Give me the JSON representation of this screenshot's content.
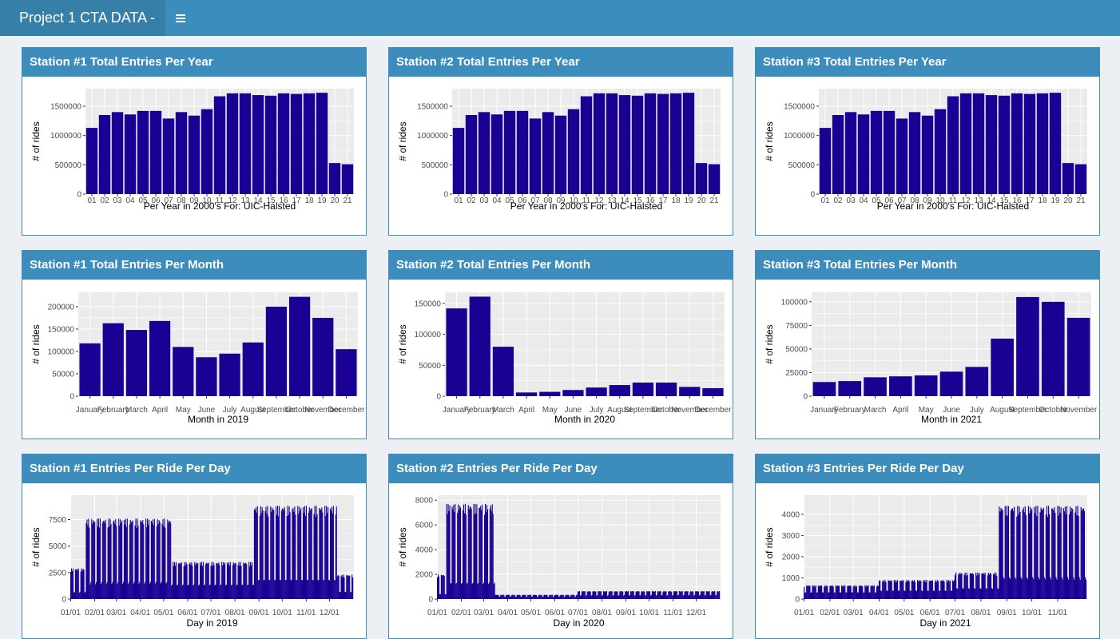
{
  "app": {
    "title": "Project 1 CTA DATA -",
    "menu_icon": "hamburger-menu-icon"
  },
  "colors": {
    "header": "#3c8dbc",
    "logo": "#367fa9",
    "bar": "#1a0093",
    "panel": "#ebebeb",
    "grid": "#ffffff",
    "page_bg": "#ecf0f5"
  },
  "boxes": [
    {
      "title": "Station #1 Total Entries Per Year",
      "chart_data": {
        "type": "bar",
        "categories": [
          "01",
          "02",
          "03",
          "04",
          "05",
          "06",
          "07",
          "08",
          "09",
          "10",
          "11",
          "12",
          "13",
          "14",
          "15",
          "16",
          "17",
          "18",
          "19",
          "20",
          "21"
        ],
        "values": [
          1130000,
          1350000,
          1400000,
          1360000,
          1420000,
          1420000,
          1290000,
          1400000,
          1340000,
          1450000,
          1670000,
          1720000,
          1720000,
          1690000,
          1680000,
          1720000,
          1710000,
          1720000,
          1730000,
          530000,
          510000
        ],
        "xlabel": "Per Year in 2000's For: UIC-Halsted",
        "ylabel": "# of rides",
        "ylim": [
          0,
          1800000
        ],
        "yticks": [
          0,
          500000,
          1000000,
          1500000
        ],
        "ytick_labels": [
          "0",
          "500000",
          "1000000",
          "1500000"
        ],
        "grid": true
      }
    },
    {
      "title": "Station #2 Total Entries Per Year",
      "chart_data": {
        "type": "bar",
        "categories": [
          "01",
          "02",
          "03",
          "04",
          "05",
          "06",
          "07",
          "08",
          "09",
          "10",
          "11",
          "12",
          "13",
          "14",
          "15",
          "16",
          "17",
          "18",
          "19",
          "20",
          "21"
        ],
        "values": [
          1130000,
          1350000,
          1400000,
          1360000,
          1420000,
          1420000,
          1290000,
          1400000,
          1340000,
          1450000,
          1670000,
          1720000,
          1720000,
          1690000,
          1680000,
          1720000,
          1710000,
          1720000,
          1730000,
          530000,
          510000
        ],
        "xlabel": "Per Year in 2000's For: UIC-Halsted",
        "ylabel": "# of rides",
        "ylim": [
          0,
          1800000
        ],
        "yticks": [
          0,
          500000,
          1000000,
          1500000
        ],
        "ytick_labels": [
          "0",
          "500000",
          "1000000",
          "1500000"
        ],
        "grid": true
      }
    },
    {
      "title": "Station #3 Total Entries Per Year",
      "chart_data": {
        "type": "bar",
        "categories": [
          "01",
          "02",
          "03",
          "04",
          "05",
          "06",
          "07",
          "08",
          "09",
          "10",
          "11",
          "12",
          "13",
          "14",
          "15",
          "16",
          "17",
          "18",
          "19",
          "20",
          "21"
        ],
        "values": [
          1130000,
          1350000,
          1400000,
          1360000,
          1420000,
          1420000,
          1290000,
          1400000,
          1340000,
          1450000,
          1670000,
          1720000,
          1720000,
          1690000,
          1680000,
          1720000,
          1710000,
          1720000,
          1730000,
          530000,
          510000
        ],
        "xlabel": "Per Year in 2000's For: UIC-Halsted",
        "ylabel": "# of rides",
        "ylim": [
          0,
          1800000
        ],
        "yticks": [
          0,
          500000,
          1000000,
          1500000
        ],
        "ytick_labels": [
          "0",
          "500000",
          "1000000",
          "1500000"
        ],
        "grid": true
      }
    },
    {
      "title": "Station #1 Total Entries Per Month",
      "chart_data": {
        "type": "bar",
        "categories": [
          "January",
          "February",
          "March",
          "April",
          "May",
          "June",
          "July",
          "August",
          "September",
          "October",
          "November",
          "December"
        ],
        "values": [
          118000,
          163000,
          148000,
          168000,
          110000,
          87000,
          95000,
          120000,
          200000,
          222000,
          175000,
          105000
        ],
        "xlabel": "Month in 2019",
        "ylabel": "# of rides",
        "ylim": [
          0,
          232000
        ],
        "yticks": [
          0,
          50000,
          100000,
          150000,
          200000
        ],
        "ytick_labels": [
          "0",
          "50000",
          "100000",
          "150000",
          "200000"
        ],
        "grid": true
      }
    },
    {
      "title": "Station #2 Total Entries Per Month",
      "chart_data": {
        "type": "bar",
        "categories": [
          "January",
          "February",
          "March",
          "April",
          "May",
          "June",
          "July",
          "August",
          "September",
          "October",
          "November",
          "December"
        ],
        "values": [
          142000,
          161000,
          80000,
          6000,
          7000,
          10000,
          14000,
          18000,
          22000,
          22000,
          15000,
          13000
        ],
        "xlabel": "Month in 2020",
        "ylabel": "# of rides",
        "ylim": [
          0,
          168000
        ],
        "yticks": [
          0,
          50000,
          100000,
          150000
        ],
        "ytick_labels": [
          "0",
          "50000",
          "100000",
          "150000"
        ],
        "grid": true
      }
    },
    {
      "title": "Station #3 Total Entries Per Month",
      "chart_data": {
        "type": "bar",
        "categories": [
          "January",
          "February",
          "March",
          "April",
          "May",
          "June",
          "July",
          "August",
          "September",
          "October",
          "November"
        ],
        "values": [
          15000,
          16000,
          20000,
          21000,
          22000,
          26000,
          31000,
          61000,
          105000,
          100000,
          83000
        ],
        "xlabel": "Month in 2021",
        "ylabel": "# of rides",
        "ylim": [
          0,
          110000
        ],
        "yticks": [
          0,
          25000,
          50000,
          75000,
          100000
        ],
        "ytick_labels": [
          "0",
          "25000",
          "50000",
          "75000",
          "100000"
        ],
        "grid": true
      }
    },
    {
      "title": "Station #1 Entries Per Ride Per Day",
      "chart_data": {
        "type": "bar",
        "x_type": "daily",
        "x_start": "2019-01-01",
        "x_end": "2019-12-31",
        "xticks": [
          "01/01",
          "02/01",
          "03/01",
          "04/01",
          "05/01",
          "06/01",
          "07/01",
          "08/01",
          "09/01",
          "10/01",
          "11/01",
          "12/01"
        ],
        "segments": [
          {
            "from": "2019-01-01",
            "to": "2019-01-20",
            "weekday": 2900,
            "weekend": 600
          },
          {
            "from": "2019-01-21",
            "to": "2019-05-10",
            "weekday": 7600,
            "weekend": 1400
          },
          {
            "from": "2019-05-11",
            "to": "2019-08-25",
            "weekday": 3500,
            "weekend": 1200
          },
          {
            "from": "2019-08-26",
            "to": "2019-12-10",
            "weekday": 8800,
            "weekend": 1600
          },
          {
            "from": "2019-12-11",
            "to": "2019-12-31",
            "weekday": 2300,
            "weekend": 600
          }
        ],
        "xlabel": "Day in 2019",
        "ylabel": "# of rides",
        "ylim": [
          0,
          9800
        ],
        "yticks": [
          0,
          2500,
          5000,
          7500
        ],
        "ytick_labels": [
          "0",
          "2500",
          "5000",
          "7500"
        ],
        "grid": true
      }
    },
    {
      "title": "Station #2 Entries Per Ride Per Day",
      "chart_data": {
        "type": "bar",
        "x_type": "daily",
        "x_start": "2020-01-01",
        "x_end": "2020-12-31",
        "xticks": [
          "01/01",
          "02/01",
          "03/01",
          "04/01",
          "05/01",
          "06/01",
          "07/01",
          "08/01",
          "09/01",
          "10/01",
          "11/01",
          "12/01"
        ],
        "segments": [
          {
            "from": "2020-01-01",
            "to": "2020-01-12",
            "weekday": 2000,
            "weekend": 400
          },
          {
            "from": "2020-01-13",
            "to": "2020-03-15",
            "weekday": 7700,
            "weekend": 1300
          },
          {
            "from": "2020-03-16",
            "to": "2020-06-30",
            "weekday": 350,
            "weekend": 200
          },
          {
            "from": "2020-07-01",
            "to": "2020-12-31",
            "weekday": 650,
            "weekend": 300
          }
        ],
        "xlabel": "Day in 2020",
        "ylabel": "# of rides",
        "ylim": [
          0,
          8400
        ],
        "yticks": [
          0,
          2000,
          4000,
          6000,
          8000
        ],
        "ytick_labels": [
          "0",
          "2000",
          "4000",
          "6000",
          "8000"
        ],
        "grid": true
      }
    },
    {
      "title": "Station #3 Entries Per Ride Per Day",
      "chart_data": {
        "type": "bar",
        "x_type": "daily",
        "x_start": "2021-01-01",
        "x_end": "2021-12-05",
        "xticks": [
          "01/01",
          "02/01",
          "03/01",
          "04/01",
          "05/01",
          "06/01",
          "07/01",
          "08/01",
          "09/01",
          "10/01",
          "11/01"
        ],
        "segments": [
          {
            "from": "2021-01-01",
            "to": "2021-03-31",
            "weekday": 650,
            "weekend": 280
          },
          {
            "from": "2021-04-01",
            "to": "2021-06-30",
            "weekday": 900,
            "weekend": 350
          },
          {
            "from": "2021-07-01",
            "to": "2021-08-22",
            "weekday": 1250,
            "weekend": 450
          },
          {
            "from": "2021-08-23",
            "to": "2021-12-05",
            "weekday": 4400,
            "weekend": 900
          }
        ],
        "xlabel": "Day in 2021",
        "ylabel": "# of rides",
        "ylim": [
          0,
          4900
        ],
        "yticks": [
          0,
          1000,
          2000,
          3000,
          4000
        ],
        "ytick_labels": [
          "0",
          "1000",
          "2000",
          "3000",
          "4000"
        ],
        "grid": true
      }
    }
  ]
}
